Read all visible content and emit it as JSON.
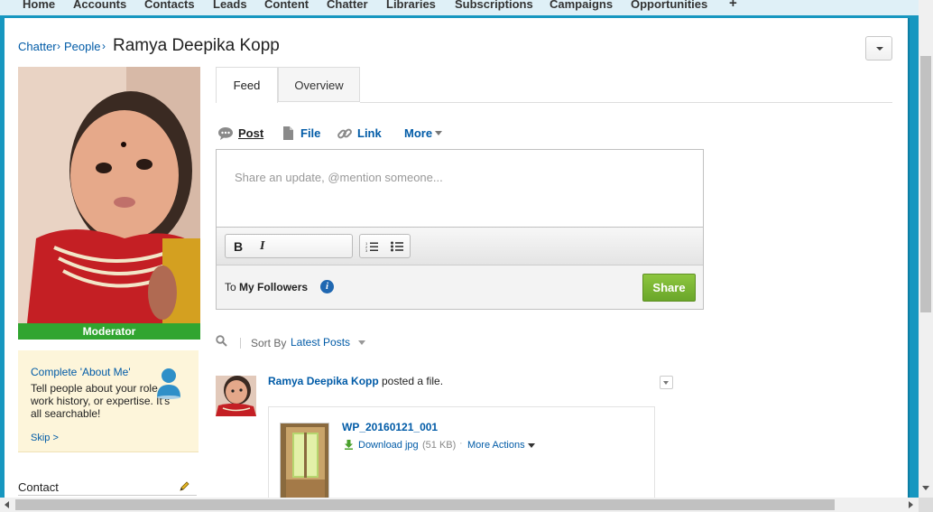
{
  "nav": {
    "tabs": [
      "Home",
      "Accounts",
      "Contacts",
      "Leads",
      "Content",
      "Chatter",
      "Libraries",
      "Subscriptions",
      "Campaigns",
      "Opportunities"
    ],
    "plus": "+"
  },
  "breadcrumb": {
    "chatter": "Chatter",
    "people": "People",
    "sep": "›"
  },
  "profile": {
    "name": "Ramya Deepika Kopp",
    "role_badge": "Moderator"
  },
  "about_me": {
    "title": "Complete 'About Me'",
    "description": "Tell people about your role, work history, or expertise. It's all searchable!",
    "skip": "Skip >"
  },
  "contact": {
    "label": "Contact"
  },
  "tabs": {
    "feed": "Feed",
    "overview": "Overview"
  },
  "publisher": {
    "post": "Post",
    "file": "File",
    "link": "Link",
    "more": "More",
    "placeholder": "Share an update, @mention someone...",
    "to_prefix": "To",
    "audience": "My Followers",
    "share": "Share",
    "bold": "B",
    "italic": "I"
  },
  "sort": {
    "label": "Sort By",
    "value": "Latest Posts"
  },
  "feed_item": {
    "author": "Ramya Deepika Kopp",
    "verb": "posted a file.",
    "file_name": "WP_20160121_001",
    "download": "Download jpg",
    "size": "(51 KB)",
    "dot": "·",
    "more_actions": "More Actions"
  },
  "colors": {
    "nav_border": "#1797c0",
    "link": "#015ba7",
    "share_green": "#7ab733",
    "moderator_green": "#31a530",
    "about_bg": "#fdf5da"
  }
}
